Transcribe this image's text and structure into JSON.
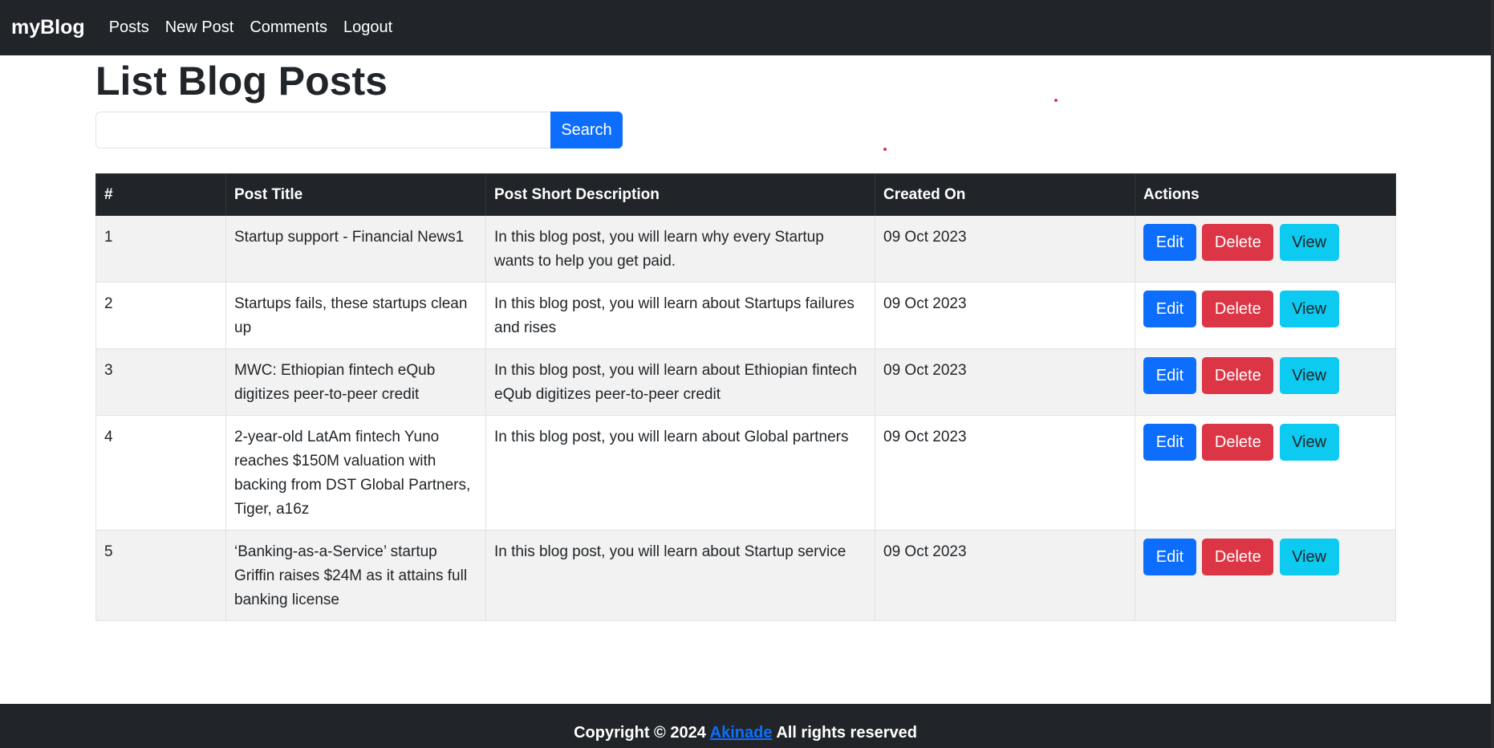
{
  "navbar": {
    "brand": "myBlog",
    "links": [
      "Posts",
      "New Post",
      "Comments",
      "Logout"
    ]
  },
  "page_title": "List Blog Posts",
  "search": {
    "value": "",
    "button_label": "Search"
  },
  "table": {
    "headers": [
      "#",
      "Post Title",
      "Post Short Description",
      "Created On",
      "Actions"
    ],
    "action_labels": {
      "edit": "Edit",
      "delete": "Delete",
      "view": "View"
    },
    "rows": [
      {
        "id": "1",
        "title": "Startup support - Financial News1",
        "description": "In this blog post, you will learn why every Startup wants to help you get paid.",
        "created": "09 Oct 2023"
      },
      {
        "id": "2",
        "title": "Startups fails, these startups clean up",
        "description": "In this blog post, you will learn about Startups failures and rises",
        "created": "09 Oct 2023"
      },
      {
        "id": "3",
        "title": "MWC: Ethiopian fintech eQub digitizes peer-to-peer credit",
        "description": "In this blog post, you will learn about Ethiopian fintech eQub digitizes peer-to-peer credit",
        "created": "09 Oct 2023"
      },
      {
        "id": "4",
        "title": "2-year-old LatAm fintech Yuno reaches $150M valuation with backing from DST Global Partners, Tiger, a16z",
        "description": "In this blog post, you will learn about Global partners",
        "created": "09 Oct 2023"
      },
      {
        "id": "5",
        "title": "‘Banking-as-a-Service’ startup Griffin raises $24M as it attains full banking license",
        "description": "In this blog post, you will learn about Startup service",
        "created": "09 Oct 2023"
      }
    ]
  },
  "footer": {
    "prefix": "Copyright © 2024",
    "link_text": "Akinade",
    "suffix": "All rights reserved"
  },
  "colors": {
    "navbar_bg": "#212529",
    "primary": "#0d6efd",
    "danger": "#dc3545",
    "info": "#0dcaf0"
  }
}
